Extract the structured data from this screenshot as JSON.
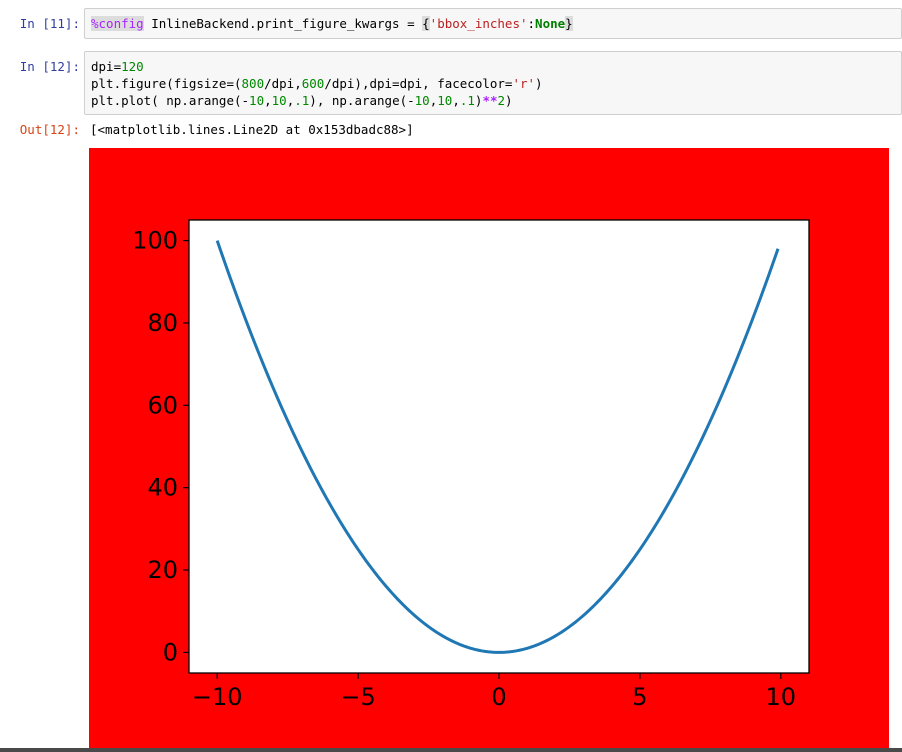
{
  "cells": [
    {
      "prompt": "In [11]:",
      "lines": [
        [
          {
            "t": "%config",
            "c": "tok-magic"
          },
          {
            "t": " InlineBackend.print_figure_kwargs = "
          },
          {
            "t": "{",
            "c": "tok-bracket"
          },
          {
            "t": "'bbox_inches'",
            "c": "tok-str"
          },
          {
            "t": ":"
          },
          {
            "t": "None",
            "c": "tok-kw"
          },
          {
            "t": "}",
            "c": "tok-bracket"
          }
        ]
      ]
    },
    {
      "prompt": "In [12]:",
      "lines": [
        [
          {
            "t": "dpi="
          },
          {
            "t": "120",
            "c": "tok-num"
          }
        ],
        [
          {
            "t": "plt.figure(figsize=("
          },
          {
            "t": "800",
            "c": "tok-num"
          },
          {
            "t": "/dpi,"
          },
          {
            "t": "600",
            "c": "tok-num"
          },
          {
            "t": "/dpi),dpi=dpi, facecolor="
          },
          {
            "t": "'r'",
            "c": "tok-str"
          },
          {
            "t": ")"
          }
        ],
        [
          {
            "t": "plt.plot( np.arange(-"
          },
          {
            "t": "10",
            "c": "tok-num"
          },
          {
            "t": ","
          },
          {
            "t": "10",
            "c": "tok-num"
          },
          {
            "t": ","
          },
          {
            "t": ".1",
            "c": "tok-num"
          },
          {
            "t": "), np.arange(-"
          },
          {
            "t": "10",
            "c": "tok-num"
          },
          {
            "t": ","
          },
          {
            "t": "10",
            "c": "tok-num"
          },
          {
            "t": ","
          },
          {
            "t": ".1",
            "c": "tok-num"
          },
          {
            "t": ")"
          },
          {
            "t": "**",
            "c": "tok-op"
          },
          {
            "t": "2",
            "c": "tok-num"
          },
          {
            "t": ")"
          }
        ]
      ]
    }
  ],
  "output": {
    "prompt": "Out[12]:",
    "text": "[<matplotlib.lines.Line2D at 0x153dbadc88>]"
  },
  "chart_data": {
    "type": "line",
    "facecolor": "#ff0000",
    "axes_facecolor": "#ffffff",
    "line_color": "#1f77b4",
    "xlim": [
      -11,
      11
    ],
    "ylim": [
      -5,
      105
    ],
    "xticks": [
      -10,
      -5,
      0,
      5,
      10
    ],
    "xtick_labels": [
      "−10",
      "−5",
      "0",
      "5",
      "10"
    ],
    "yticks": [
      0,
      20,
      40,
      60,
      80,
      100
    ],
    "ytick_labels": [
      "0",
      "20",
      "40",
      "60",
      "80",
      "100"
    ],
    "grid": false,
    "series": [
      {
        "x_start": -10,
        "x_stop": 10,
        "x_step": 0.1,
        "function": "x**2"
      }
    ]
  }
}
